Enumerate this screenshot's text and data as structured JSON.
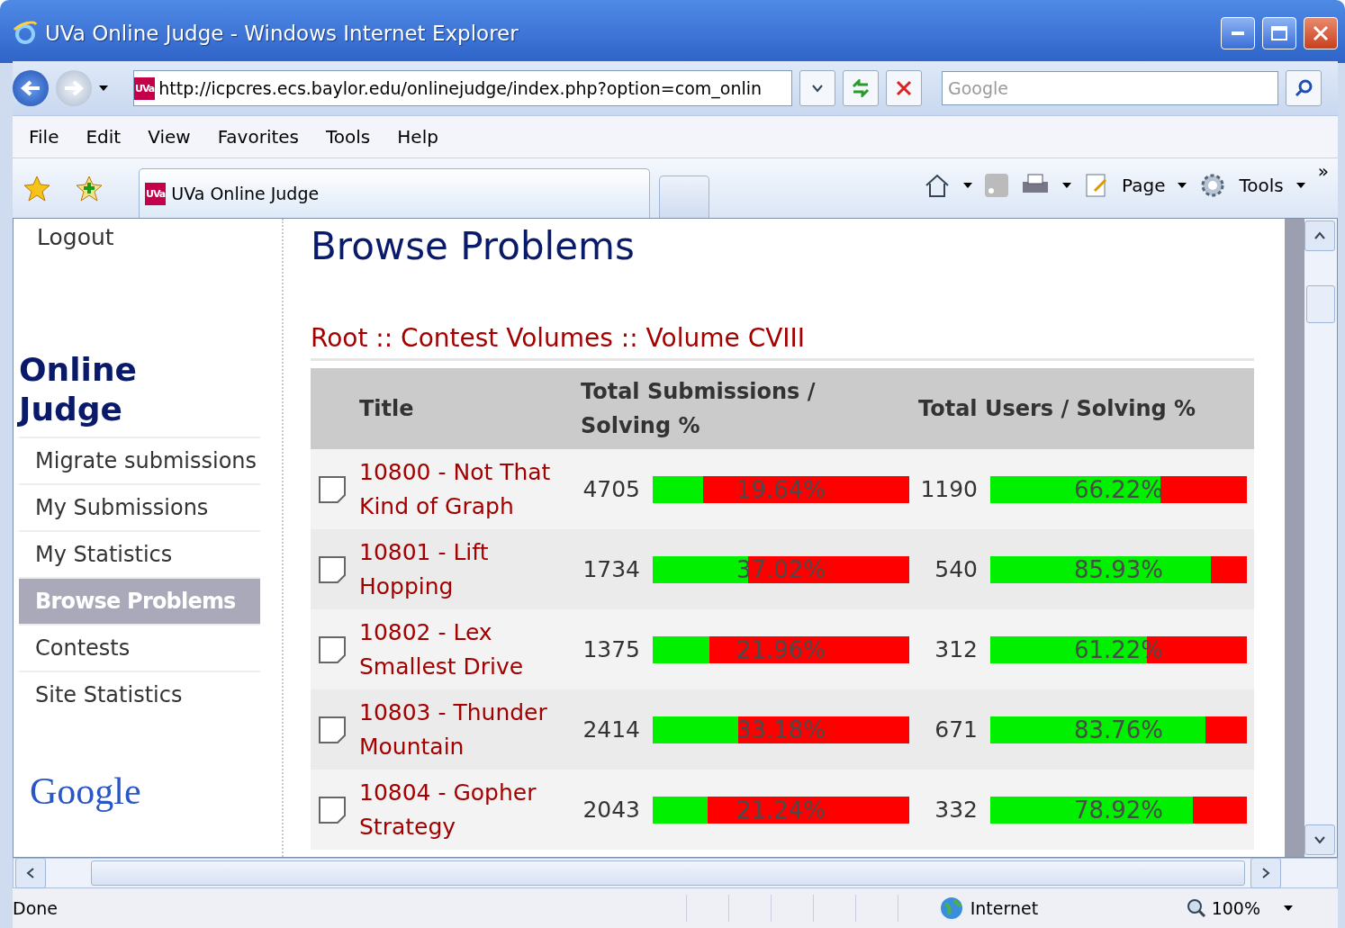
{
  "window": {
    "title": "UVa Online Judge - Windows Internet Explorer"
  },
  "address_bar": {
    "favicon": "UVa",
    "url": "http://icpcres.ecs.baylor.edu/onlinejudge/index.php?option=com_onlin"
  },
  "search": {
    "placeholder": "Google"
  },
  "menu": [
    "File",
    "Edit",
    "View",
    "Favorites",
    "Tools",
    "Help"
  ],
  "tab": {
    "favicon": "UVa",
    "label": "UVa Online Judge"
  },
  "command_bar": {
    "page": "Page",
    "tools": "Tools",
    "overflow": "»"
  },
  "sidebar": {
    "logout": "Logout",
    "heading": "Online Judge",
    "items": [
      {
        "label": "Migrate submissions",
        "selected": false
      },
      {
        "label": "My Submissions",
        "selected": false
      },
      {
        "label": "My Statistics",
        "selected": false
      },
      {
        "label": "Browse Problems",
        "selected": true
      },
      {
        "label": "Contests",
        "selected": false
      },
      {
        "label": "Site Statistics",
        "selected": false
      }
    ],
    "logo": "Google"
  },
  "main": {
    "title": "Browse Problems",
    "breadcrumb": "Root :: Contest Volumes :: Volume CVIII",
    "table": {
      "columns": [
        "Title",
        "Total Submissions / Solving %",
        "Total Users / Solving %"
      ],
      "rows": [
        {
          "title": "10800 - Not That Kind of Graph",
          "submissions": "4705",
          "submissions_pct": "19.64%",
          "submissions_bar": {
            "level": 0.1964
          },
          "users": "1190",
          "users_pct": "66.22%",
          "users_bar": {
            "level": 0.6622
          }
        },
        {
          "title": "10801 - Lift Hopping",
          "submissions": "1734",
          "submissions_pct": "37.02%",
          "submissions_bar": {
            "level": 0.3702
          },
          "users": "540",
          "users_pct": "85.93%",
          "users_bar": {
            "level": 0.8593
          }
        },
        {
          "title": "10802 - Lex Smallest Drive",
          "submissions": "1375",
          "submissions_pct": "21.96%",
          "submissions_bar": {
            "level": 0.2196
          },
          "users": "312",
          "users_pct": "61.22%",
          "users_bar": {
            "level": 0.6122
          }
        },
        {
          "title": "10803 - Thunder Mountain",
          "submissions": "2414",
          "submissions_pct": "33.18%",
          "submissions_bar": {
            "level": 0.3318
          },
          "users": "671",
          "users_pct": "83.76%",
          "users_bar": {
            "level": 0.8376
          }
        },
        {
          "title": "10804 - Gopher Strategy",
          "submissions": "2043",
          "submissions_pct": "21.24%",
          "submissions_bar": {
            "level": 0.2124
          },
          "users": "332",
          "users_pct": "78.92%",
          "users_bar": {
            "level": 0.7892
          }
        }
      ]
    }
  },
  "status_bar": {
    "text": "Done",
    "zone": "Internet",
    "zoom": "100%"
  }
}
